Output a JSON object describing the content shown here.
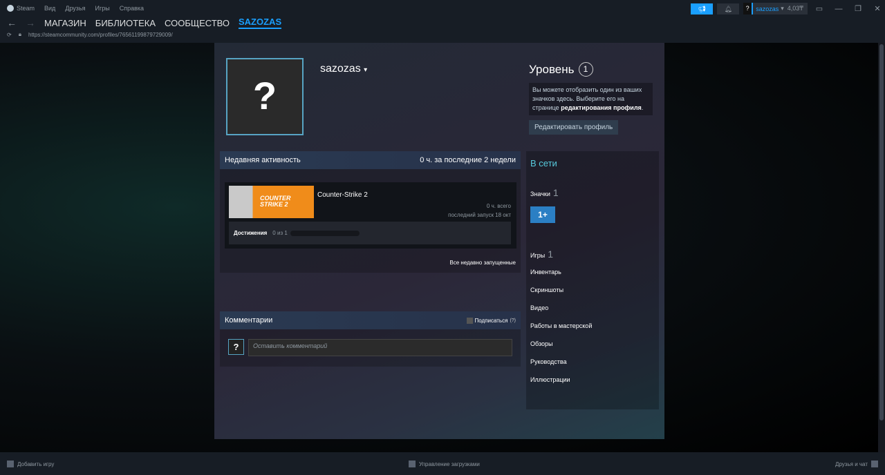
{
  "menu": {
    "steam": "Steam",
    "items": [
      "Вид",
      "Друзья",
      "Игры",
      "Справка"
    ]
  },
  "nav": {
    "back": "←",
    "forward": "→",
    "tabs": [
      "МАГАЗИН",
      "БИБЛИОТЕКА",
      "СООБЩЕСТВО",
      "SAZOZAS"
    ],
    "url": "https://steamcommunity.com/profiles/76561199879729009/"
  },
  "account": {
    "avatar": "?",
    "name": "sazozas",
    "balance": "4,03₸"
  },
  "profile": {
    "avatar": "?",
    "username": "sazozas",
    "level_label": "Уровень",
    "level": "1",
    "badge_info_1": "Вы можете отобразить один из ваших значков здесь. Выберите его на странице ",
    "badge_info_link": "редактирования профиля",
    "badge_info_end": ".",
    "edit_button": "Редактировать профиль"
  },
  "activity": {
    "title": "Недавняя активность",
    "summary": "0 ч. за последние 2 недели",
    "game": {
      "name": "Counter-Strike 2",
      "capsule_text": "COUNTER STRIKE 2",
      "total": "0 ч. всего",
      "last": "последний запуск 18 окт",
      "ach_label": "Достижения",
      "ach_value": "0 из 1",
      "ach_progress": 0
    },
    "all_link": "Все недавно запущенные"
  },
  "comments": {
    "title": "Комментарии",
    "subscribe": "Подписаться",
    "help": "(?)",
    "avatar": "?",
    "placeholder": "Оставить комментарий"
  },
  "sidebar": {
    "status": "В сети",
    "badges_label": "Значки",
    "badges_count": "1",
    "badge_icon": "1+",
    "games_label": "Игры",
    "games_count": "1",
    "links": [
      "Инвентарь",
      "Скриншоты",
      "Видео",
      "Работы в мастерской",
      "Обзоры",
      "Руководства",
      "Иллюстрации"
    ]
  },
  "bottom": {
    "add_game": "Добавить игру",
    "downloads": "Управление загрузками",
    "friends": "Друзья и чат"
  }
}
